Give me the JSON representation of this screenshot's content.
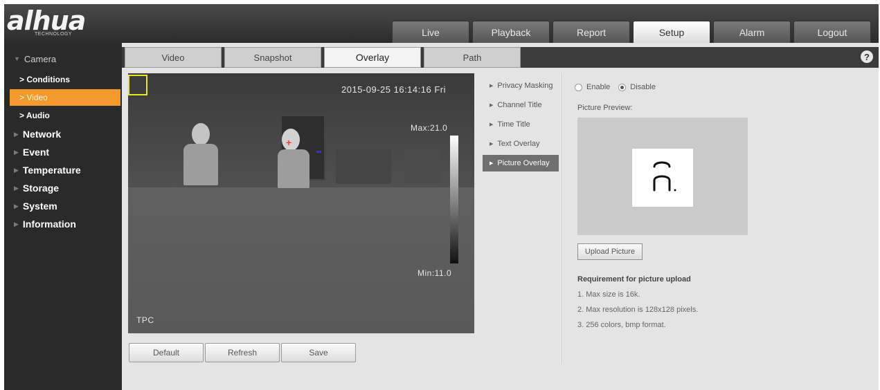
{
  "brand": {
    "logo_text": "alhua",
    "logo_sub": "TECHNOLOGY"
  },
  "main_tabs": [
    {
      "label": "Live"
    },
    {
      "label": "Playback"
    },
    {
      "label": "Report"
    },
    {
      "label": "Setup",
      "active": true
    },
    {
      "label": "Alarm"
    },
    {
      "label": "Logout"
    }
  ],
  "sidebar": {
    "camera": "Camera",
    "camera_sub": [
      {
        "label": "> Conditions"
      },
      {
        "label": "> Video",
        "active": true
      },
      {
        "label": "> Audio"
      }
    ],
    "items": [
      {
        "label": "Network"
      },
      {
        "label": "Event"
      },
      {
        "label": "Temperature"
      },
      {
        "label": "Storage"
      },
      {
        "label": "System"
      },
      {
        "label": "Information"
      }
    ]
  },
  "sub_tabs": [
    {
      "label": "Video"
    },
    {
      "label": "Snapshot"
    },
    {
      "label": "Overlay",
      "active": true
    },
    {
      "label": "Path"
    }
  ],
  "help_icon": "?",
  "video": {
    "timestamp": "2015-09-25 16:14:16 Fri",
    "max_label": "Max:21.0",
    "min_label": "Min:11.0",
    "channel_title": "TPC"
  },
  "buttons": {
    "default": "Default",
    "refresh": "Refresh",
    "save": "Save"
  },
  "overlay_menu": [
    {
      "label": "Privacy Masking"
    },
    {
      "label": "Channel Title"
    },
    {
      "label": "Time Title"
    },
    {
      "label": "Text Overlay"
    },
    {
      "label": "Picture Overlay",
      "active": true
    }
  ],
  "picture_overlay": {
    "enable_label": "Enable",
    "disable_label": "Disable",
    "selected": "Disable",
    "preview_label": "Picture Preview:",
    "upload_label": "Upload Picture",
    "requirements_title": "Requirement for picture upload",
    "requirements": [
      "1. Max size is 16k.",
      "2. Max resolution is 128x128 pixels.",
      "3. 256 colors, bmp format."
    ]
  },
  "colors": {
    "accent_orange": "#f39a2e",
    "sidebar_bg": "#2a2a2a",
    "region_box": "#e7e71a"
  }
}
